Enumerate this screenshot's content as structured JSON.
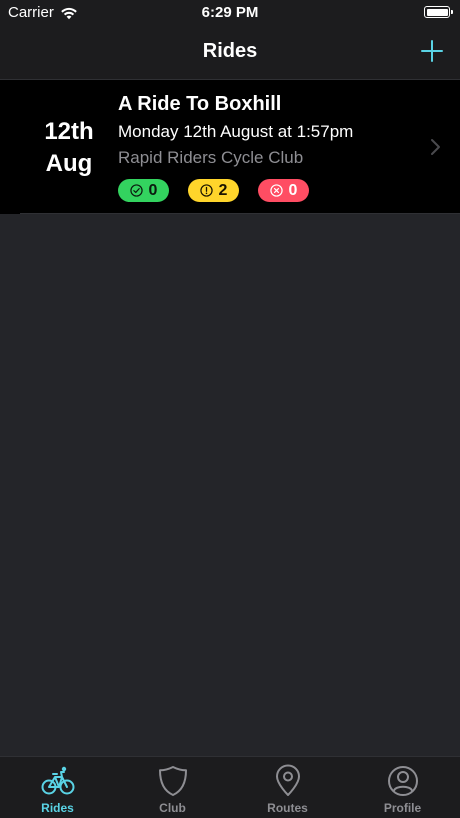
{
  "status_bar": {
    "carrier": "Carrier",
    "time": "6:29 PM"
  },
  "nav": {
    "title": "Rides",
    "add_icon": "plus-icon"
  },
  "rides": [
    {
      "day": "12th",
      "month": "Aug",
      "title": "A Ride To Boxhill",
      "datetime": "Monday 12th August at 1:57pm",
      "club": "Rapid Riders Cycle Club",
      "counts": {
        "going": "0",
        "maybe": "2",
        "not_going": "0"
      }
    }
  ],
  "tabs": [
    {
      "label": "Rides",
      "icon": "bicycle-icon",
      "active": true
    },
    {
      "label": "Club",
      "icon": "shield-icon",
      "active": false
    },
    {
      "label": "Routes",
      "icon": "map-pin-icon",
      "active": false
    },
    {
      "label": "Profile",
      "icon": "user-circle-icon",
      "active": false
    }
  ],
  "colors": {
    "accent": "#5ad3e5",
    "going": "#33d35f",
    "maybe": "#ffd52b",
    "not_going": "#ff4d63"
  }
}
